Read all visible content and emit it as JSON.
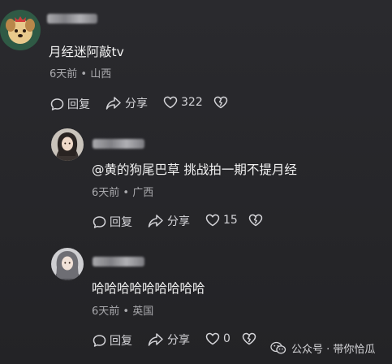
{
  "comments": [
    {
      "text": "月经迷阿敲tv",
      "time": "6天前",
      "location": "山西",
      "reply_label": "回复",
      "share_label": "分享",
      "likes": "322"
    },
    {
      "text": "@黄的狗尾巴草 挑战拍一期不提月经",
      "time": "6天前",
      "location": "广西",
      "reply_label": "回复",
      "share_label": "分享",
      "likes": "15"
    },
    {
      "text": "哈哈哈哈哈哈哈哈哈",
      "time": "6天前",
      "location": "英国",
      "reply_label": "回复",
      "share_label": "分享",
      "likes": "0"
    }
  ],
  "separator": "•",
  "watermark": {
    "text": "公众号 · 带你恰瓜"
  },
  "icons": {
    "reply": "speech-bubble-icon",
    "share": "share-arrow-icon",
    "like": "heart-icon",
    "dislike": "broken-heart-icon",
    "watermark": "wechat-icon"
  }
}
